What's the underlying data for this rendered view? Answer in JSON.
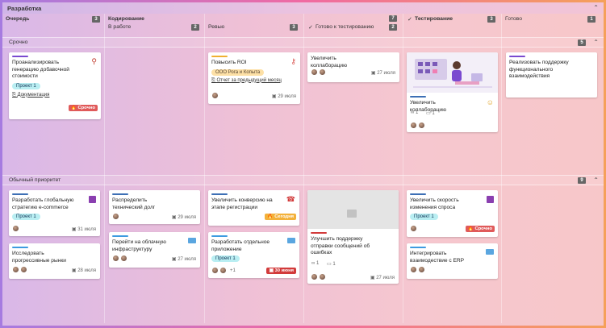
{
  "board": {
    "title": "Разработка"
  },
  "columns": [
    {
      "name": "Очередь",
      "count": "3"
    },
    {
      "name": "Кодирование",
      "sub": "В работе",
      "count": "2"
    },
    {
      "name": "",
      "sub": "Ревью",
      "count": "3"
    },
    {
      "name": "",
      "sub": "Готово к тестированию",
      "count": "2",
      "top_count": "7"
    },
    {
      "name": "Тестирование",
      "count": "3"
    },
    {
      "name": "Готово",
      "count": "1"
    }
  ],
  "lanes": {
    "urgent": {
      "name": "Срочно",
      "count": "5"
    },
    "normal": {
      "name": "Обычный приоритет",
      "count": "9"
    }
  },
  "cards": {
    "c1": {
      "title": "Проанализировать генерацию добавочной стоимости",
      "tag": "Проект 1",
      "doc": "Документация",
      "urgency": "Срочно"
    },
    "c2": {
      "title": "Повысить ROI",
      "tag": "ООО Рога и Копыта",
      "doc": "Отчет за предыдущий месяц",
      "date": "29 июля"
    },
    "c3": {
      "title": "Увеличить коллаборацию",
      "date": "27 июля"
    },
    "c4": {
      "title": "Увеличить коллаборацию",
      "links": "1",
      "comments": "1"
    },
    "c5": {
      "title": "Реализовать поддержку функционального взаимодействия"
    },
    "n1": {
      "title": "Разработать глобальную стратегию e-commerce",
      "tag": "Проект 1",
      "date": "31 июля"
    },
    "n2": {
      "title": "Исследовать прогрессивные рынки",
      "date": "28 июля"
    },
    "n3": {
      "title": "Распределить технический долг",
      "date": "29 июля"
    },
    "n4": {
      "title": "Перейти на облачную инфраструктуру",
      "date": "27 июля"
    },
    "n5": {
      "title": "Увеличить конверсию на этапе регистрации",
      "urgency": "Сегодня"
    },
    "n6": {
      "title": "Разработать отдельное приложение",
      "tag": "Проект 1",
      "extra": "+1",
      "urgency": "30 июня"
    },
    "n7": {
      "title": "Улучшить поддержку отправки сообщений об ошибках",
      "links": "1",
      "comments": "1",
      "date": "27 июля"
    },
    "n8": {
      "title": "Увеличить скорость изменения спроса",
      "tag": "Проект 1",
      "urgency": "Срочно"
    },
    "n9": {
      "title": "Интегрировать взаимодествие с ERP"
    }
  }
}
